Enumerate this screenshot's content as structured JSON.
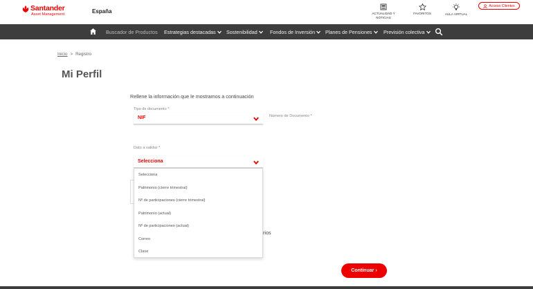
{
  "header": {
    "brand_name": "Santander",
    "brand_sub": "Asset Management",
    "country": "España",
    "actions": [
      {
        "icon": "newspaper-icon",
        "label_line1": "ACTUALIDAD Y",
        "label_line2": "NOTICIAS"
      },
      {
        "icon": "star-icon",
        "label_line1": "FAVORITOS",
        "label_line2": ""
      },
      {
        "icon": "lightbulb-icon",
        "label_line1": "AULA VIRTUAL",
        "label_line2": ""
      }
    ],
    "acceso_label": "Acceso Clientes",
    "brand_color": "#ec0000"
  },
  "nav": {
    "items": [
      {
        "label": "Buscador de Productos",
        "has_chevron": false
      },
      {
        "label": "Estrategias destacadas",
        "has_chevron": true
      },
      {
        "label": "Sostenibilidad",
        "has_chevron": true
      },
      {
        "label": "Fondos de Inversión",
        "has_chevron": true
      },
      {
        "label": "Planes de Pensiones",
        "has_chevron": true
      },
      {
        "label": "Previsión colectiva",
        "has_chevron": true
      }
    ],
    "bg_color": "#3d3d3d"
  },
  "breadcrumb": {
    "home": "Inicio",
    "separator": ">",
    "current": "Registro"
  },
  "page": {
    "title": "Mi Perfil",
    "intro": "Rellene la información que le mostramos a continuación"
  },
  "form": {
    "doc_type_label": "Tipo de documento *",
    "doc_type_value": "NIF",
    "doc_number_label": "Número de Documento *",
    "dato_label": "Dato a validar *",
    "dato_value": "Selecciona",
    "dato_options": [
      "Selecciona",
      "Patrimonio (cierre trimestral)",
      "Nº de participaciones (cierre trimestral)",
      "Patrimonio (actual)",
      "Nº de participaciones (actual)",
      "Correo",
      "Clave"
    ],
    "hidden_text_fragment": "rios",
    "continue_label": "Continuar",
    "continue_arrow": "›"
  }
}
